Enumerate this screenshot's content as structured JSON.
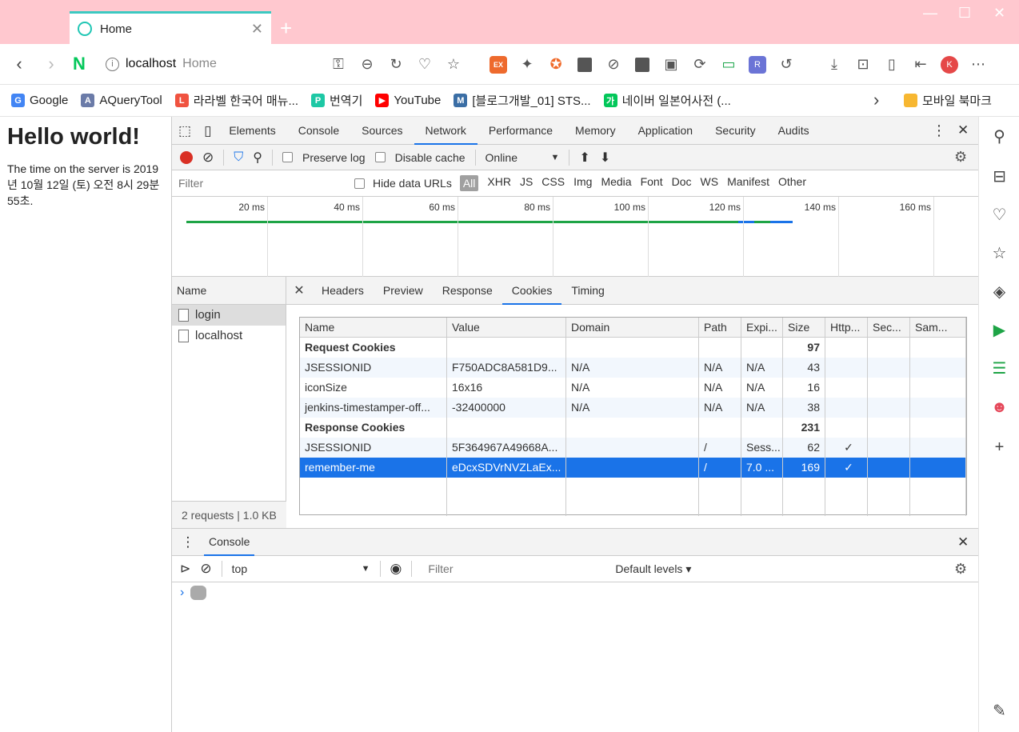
{
  "browser": {
    "tab_title": "Home",
    "tab_close": "✕",
    "new_tab": "+",
    "address_host": "localhost",
    "address_title": "Home",
    "naver_label": "N",
    "ex_label": "EX",
    "profile_initial": "K",
    "rss_label": "R",
    "window_controls": [
      "—",
      "☐",
      "✕"
    ]
  },
  "bookmarks": [
    {
      "label": "Google",
      "icon": "google-icon",
      "color": "#4285f4",
      "glyph": "G"
    },
    {
      "label": "AQueryTool",
      "icon": "aquerytool-icon",
      "color": "#6b7ba8",
      "glyph": "A"
    },
    {
      "label": "라라벨 한국어 매뉴...",
      "icon": "laravel-icon",
      "color": "#f05340",
      "glyph": "L"
    },
    {
      "label": "번역기",
      "icon": "papago-icon",
      "color": "#1ec8a5",
      "glyph": "P"
    },
    {
      "label": "YouTube",
      "icon": "youtube-icon",
      "color": "#ff0000",
      "glyph": "▶"
    },
    {
      "label": "[블로그개발_01] STS...",
      "icon": "blog-icon",
      "color": "#3b6ea5",
      "glyph": "M"
    },
    {
      "label": "네이버 일본어사전 (...",
      "icon": "naver-dict-icon",
      "color": "#03c75a",
      "glyph": "가"
    }
  ],
  "bookmarks_more": "›",
  "mobile_bookmarks": "모바일 북마크",
  "page": {
    "heading": "Hello world!",
    "body": "The time on the server is 2019년 10월 12일 (토) 오전 8시 29분 55초."
  },
  "devtools": {
    "tabs": [
      "Elements",
      "Console",
      "Sources",
      "Network",
      "Performance",
      "Memory",
      "Application",
      "Security",
      "Audits"
    ],
    "active_tab": "Network",
    "more_glyph": "⋮",
    "close_glyph": "✕",
    "toolbar": {
      "preserve_log": "Preserve log",
      "disable_cache": "Disable cache",
      "throttle": "Online"
    },
    "filter_placeholder": "Filter",
    "hide_data_urls": "Hide data URLs",
    "filter_types": [
      "All",
      "XHR",
      "JS",
      "CSS",
      "Img",
      "Media",
      "Font",
      "Doc",
      "WS",
      "Manifest",
      "Other"
    ],
    "timeline_ticks": [
      "20 ms",
      "40 ms",
      "60 ms",
      "80 ms",
      "100 ms",
      "120 ms",
      "140 ms",
      "160 ms"
    ],
    "request_list": {
      "header": "Name",
      "items": [
        "login",
        "localhost"
      ],
      "selected": "login",
      "footer": "2 requests | 1.0 KB"
    },
    "detail_tabs": [
      "Headers",
      "Preview",
      "Response",
      "Cookies",
      "Timing"
    ],
    "active_detail_tab": "Cookies",
    "cookies": {
      "columns": [
        "Name",
        "Value",
        "Domain",
        "Path",
        "Expi...",
        "Size",
        "Http...",
        "Sec...",
        "Sam..."
      ],
      "rows": [
        {
          "section": true,
          "name": "Request Cookies",
          "size": "97"
        },
        {
          "name": "JSESSIONID",
          "value": "F750ADC8A581D9...",
          "domain": "N/A",
          "path": "N/A",
          "expires": "N/A",
          "size": "43",
          "http": "",
          "secure": "",
          "same": ""
        },
        {
          "name": "iconSize",
          "value": "16x16",
          "domain": "N/A",
          "path": "N/A",
          "expires": "N/A",
          "size": "16",
          "http": "",
          "secure": "",
          "same": ""
        },
        {
          "name": "jenkins-timestamper-off...",
          "value": "-32400000",
          "domain": "N/A",
          "path": "N/A",
          "expires": "N/A",
          "size": "38",
          "http": "",
          "secure": "",
          "same": ""
        },
        {
          "section": true,
          "name": "Response Cookies",
          "size": "231"
        },
        {
          "name": "JSESSIONID",
          "value": "5F364967A49668A...",
          "domain": "",
          "path": "/",
          "expires": "Sess...",
          "size": "62",
          "http": "✓",
          "secure": "",
          "same": ""
        },
        {
          "name": "remember-me",
          "value": "eDcxSDVrNVZLaEx...",
          "domain": "",
          "path": "/",
          "expires": "7.0 ...",
          "size": "169",
          "http": "✓",
          "secure": "",
          "same": "",
          "selected": true
        }
      ]
    },
    "drawer": {
      "tab": "Console",
      "context": "top",
      "filter_placeholder": "Filter",
      "levels": "Default levels ▾",
      "prompt": "›"
    }
  },
  "colors": {
    "titlebar": "#ffc8cf",
    "accent": "#1a73e8",
    "tab_accent": "#3cc9c1",
    "record": "#d93025"
  }
}
